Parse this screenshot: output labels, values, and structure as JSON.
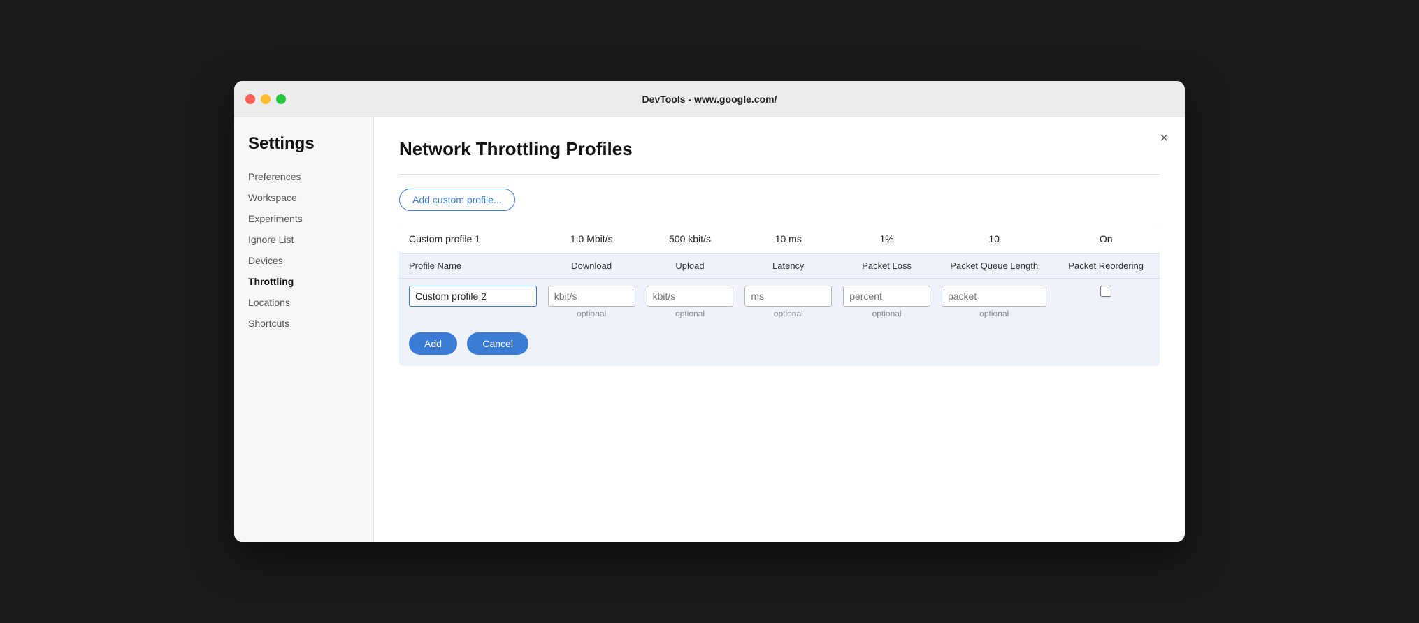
{
  "window": {
    "title": "DevTools - www.google.com/"
  },
  "sidebar": {
    "heading": "Settings",
    "items": [
      {
        "id": "preferences",
        "label": "Preferences",
        "active": false
      },
      {
        "id": "workspace",
        "label": "Workspace",
        "active": false
      },
      {
        "id": "experiments",
        "label": "Experiments",
        "active": false
      },
      {
        "id": "ignore-list",
        "label": "Ignore List",
        "active": false
      },
      {
        "id": "devices",
        "label": "Devices",
        "active": false
      },
      {
        "id": "throttling",
        "label": "Throttling",
        "active": true
      },
      {
        "id": "locations",
        "label": "Locations",
        "active": false
      },
      {
        "id": "shortcuts",
        "label": "Shortcuts",
        "active": false
      }
    ]
  },
  "main": {
    "page_title": "Network Throttling Profiles",
    "add_button_label": "Add custom profile...",
    "close_label": "×",
    "table": {
      "columns": [
        "Profile Name",
        "Download",
        "Upload",
        "Latency",
        "Packet Loss",
        "Packet Queue Length",
        "Packet Reordering"
      ],
      "existing_rows": [
        {
          "name": "Custom profile 1",
          "download": "1.0 Mbit/s",
          "upload": "500 kbit/s",
          "latency": "10 ms",
          "loss": "1%",
          "queue": "10",
          "reorder": "On"
        }
      ],
      "new_row": {
        "name_value": "Custom profile 2",
        "name_placeholder": "",
        "download_placeholder": "kbit/s",
        "download_hint": "optional",
        "upload_placeholder": "kbit/s",
        "upload_hint": "optional",
        "latency_placeholder": "ms",
        "latency_hint": "optional",
        "loss_placeholder": "percent",
        "loss_hint": "optional",
        "queue_placeholder": "packet",
        "queue_hint": "optional"
      },
      "add_button": "Add",
      "cancel_button": "Cancel"
    }
  }
}
